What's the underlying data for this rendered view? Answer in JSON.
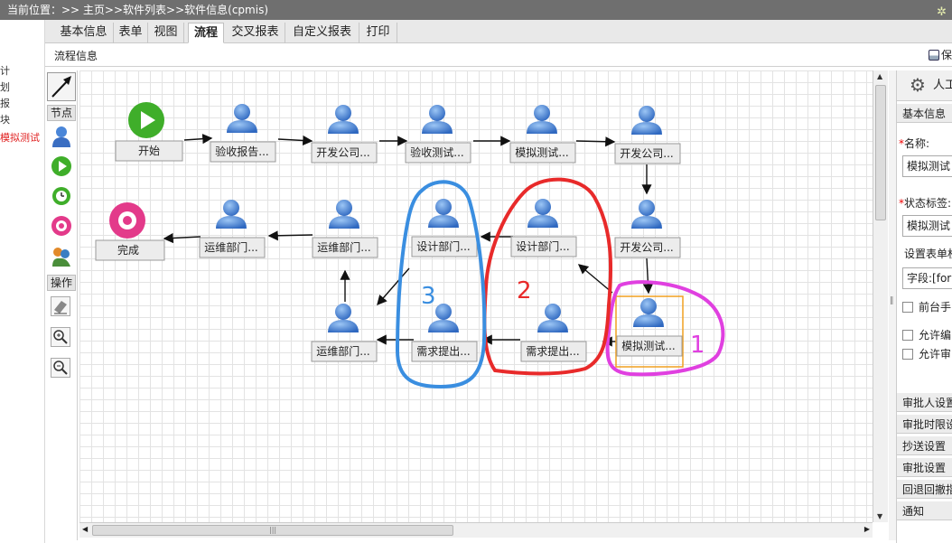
{
  "breadcrumb": "当前位置：>> 主页>>软件列表>>软件信息(cpmis)",
  "left_clip": [
    "计",
    "划",
    "报",
    "块",
    "模拟测试"
  ],
  "tabs": [
    "基本信息",
    "表单",
    "视图",
    "流程",
    "交叉报表",
    "自定义报表",
    "打印"
  ],
  "active_tab": "流程",
  "subbar": {
    "title": "流程信息",
    "save_label": "保"
  },
  "toolbox": {
    "nodes_label": "节点",
    "ops_label": "操作"
  },
  "nodes": {
    "start": "开始",
    "n1": "验收报告...",
    "n2": "开发公司...",
    "n3": "验收测试...",
    "n4": "模拟测试...",
    "n5": "开发公司...",
    "end": "完成",
    "r1": "运维部门...",
    "r2": "运维部门...",
    "r3": "设计部门...",
    "r4": "设计部门...",
    "r5": "开发公司...",
    "b1": "运维部门...",
    "b2": "需求提出...",
    "b3": "需求提出...",
    "b4": "模拟测试..."
  },
  "annotations": {
    "a1": "1",
    "a2": "2",
    "a3": "3"
  },
  "annotation_colors": {
    "a1": "#e040e0",
    "a2": "#e82a2a",
    "a3": "#3a8ee0"
  },
  "right_panel": {
    "header": "人工",
    "section_basic": "基本信息",
    "name_label": "名称:",
    "name_value": "模拟测试",
    "status_label": "状态标签:",
    "status_value": "模拟测试",
    "form_label": "设置表单权",
    "field_value": "字段:[form",
    "check1": "前台手",
    "check2": "允许编",
    "check3": "允许审",
    "sections": [
      "审批人设置",
      "审批时限设",
      "抄送设置",
      "审批设置",
      "回退回撤指",
      "通知"
    ]
  }
}
